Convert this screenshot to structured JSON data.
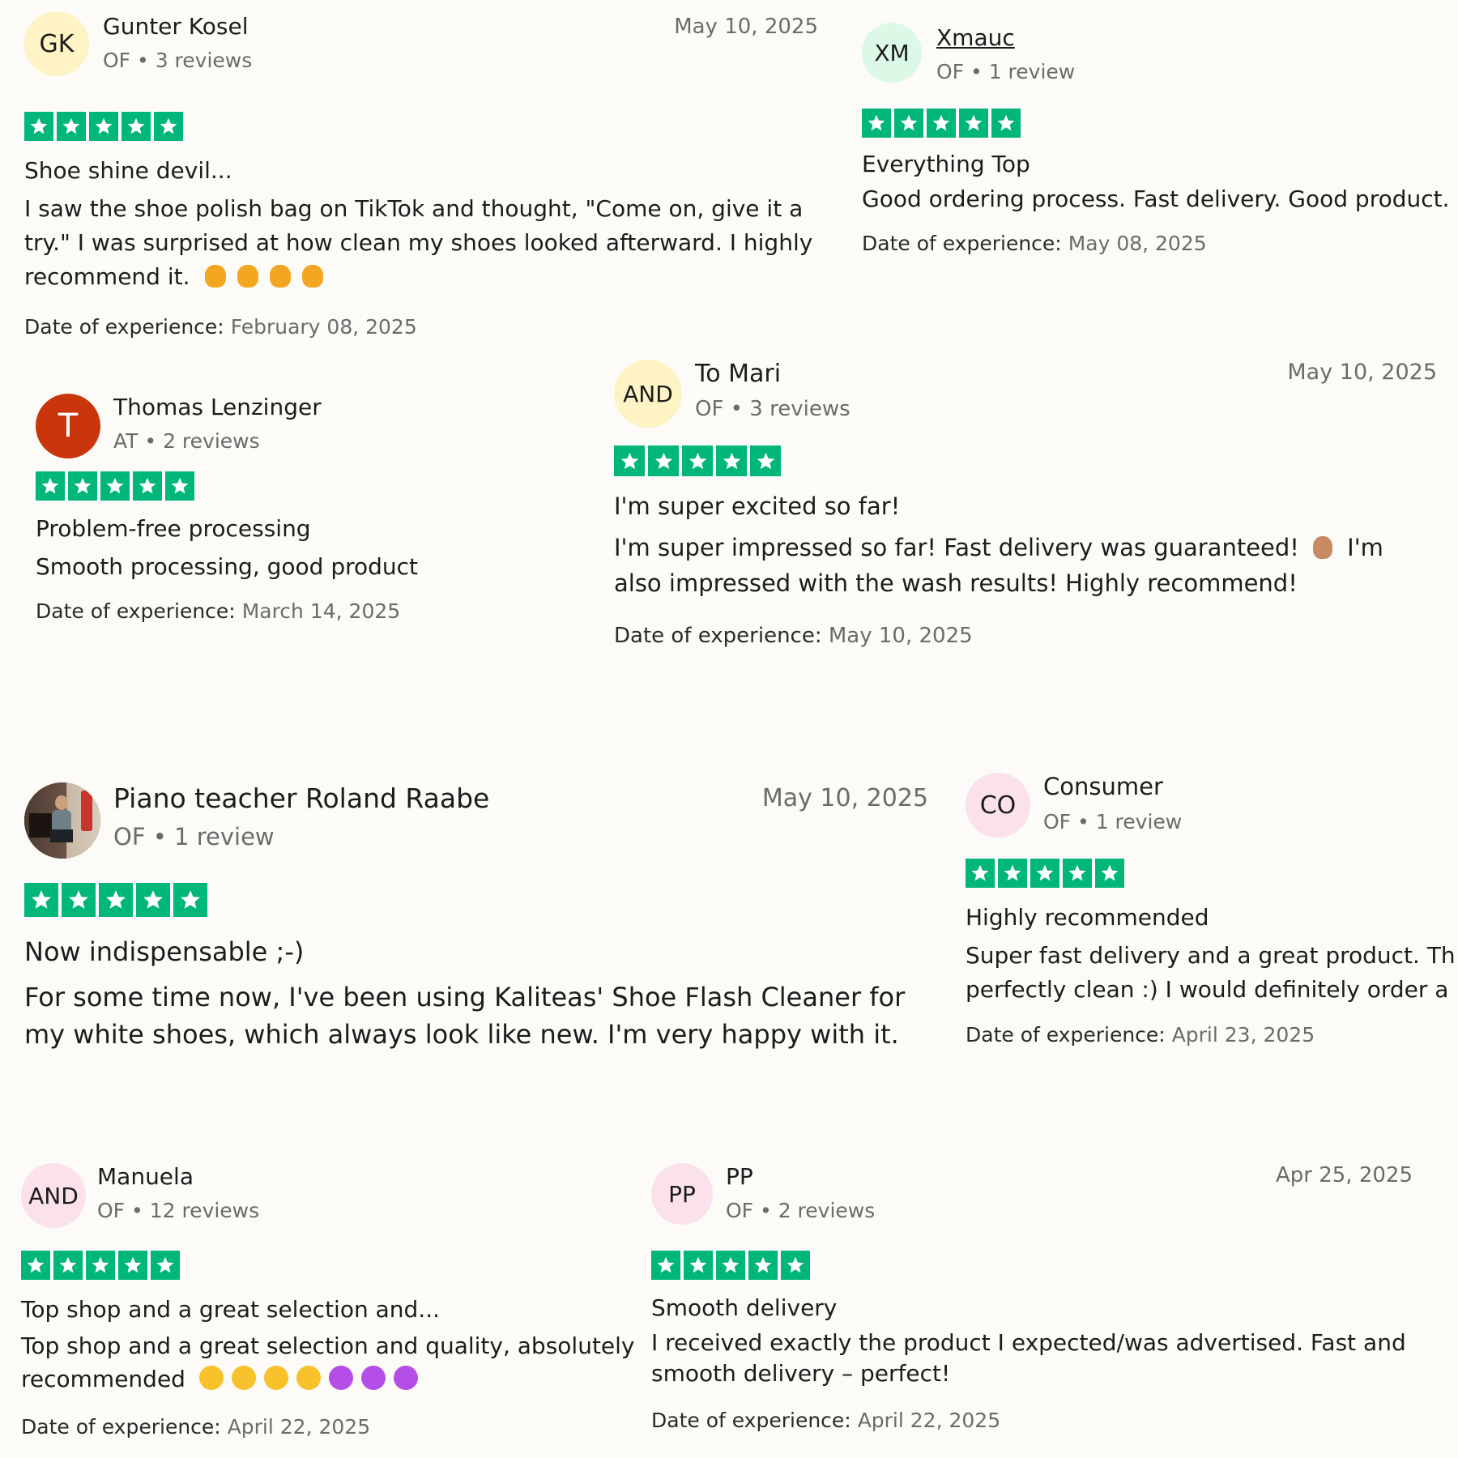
{
  "colors": {
    "star_green": "#00b67a",
    "text": "#1c1c1c",
    "muted": "#6b6b6b"
  },
  "reviews": [
    {
      "initials": "GK",
      "name": "Gunter Kosel",
      "meta": "OF • 3 reviews",
      "date": "May 10, 2025",
      "rating": 5,
      "title": "Shoe shine devil...",
      "body": "I saw the shoe polish bag on TikTok and thought, \"Come on, give it a try.\" I was surprised at how clean my shoes looked afterward. I highly recommend it.",
      "emojis": [
        "thumbs-up",
        "thumbs-up",
        "thumbs-up",
        "thumbs-up"
      ],
      "exp_label": "Date of experience:",
      "exp_date": "February 08, 2025",
      "avatar_color": "#fdf3c4"
    },
    {
      "initials": "XM",
      "name": "Xmauc",
      "meta": "OF • 1 review",
      "date": "",
      "rating": 5,
      "title": "Everything Top",
      "body": "Good ordering process. Fast delivery. Good product.",
      "exp_label": "Date of experience:",
      "exp_date": "May 08, 2025",
      "avatar_color": "#dcf8e6"
    },
    {
      "initials": "T",
      "name": "Thomas Lenzinger",
      "meta": "AT • 2 reviews",
      "date": "",
      "rating": 5,
      "title": "Problem-free processing",
      "body": "Smooth processing, good product",
      "exp_label": "Date of experience:",
      "exp_date": "March 14, 2025",
      "avatar_color": "#c9360c"
    },
    {
      "initials": "AND",
      "name": "To Mari",
      "meta": "OF • 3 reviews",
      "date": "May 10, 2025",
      "rating": 5,
      "title": "I'm super excited so far!",
      "body_a": "I'm super impressed so far! Fast delivery was guaranteed!",
      "body_b": "I'm also impressed with the wash results! Highly recommend!",
      "emojis": [
        "thumbs-up-medium-skin"
      ],
      "exp_label": "Date of experience:",
      "exp_date": "May 10, 2025",
      "avatar_color": "#fdf3c4"
    },
    {
      "initials": "",
      "name": "Piano teacher Roland Raabe",
      "meta": "OF • 1 review",
      "date": "May 10, 2025",
      "rating": 5,
      "title": "Now indispensable ;-)",
      "body": "For some time now, I've been using Kaliteas' Shoe Flash Cleaner for my white shoes, which always look like new. I'm very happy with it.",
      "avatar_icon": "profile-photo"
    },
    {
      "initials": "CO",
      "name": "Consumer",
      "meta": "OF • 1 review",
      "date": "",
      "rating": 5,
      "title": "Highly recommended",
      "body": "Super fast delivery and a great product. Th perfectly clean :) I would definitely order a",
      "exp_label": "Date of experience:",
      "exp_date": "April 23, 2025",
      "avatar_color": "#fbe1ec"
    },
    {
      "initials": "AND",
      "name": "Manuela",
      "meta": "OF • 12 reviews",
      "date": "",
      "rating": 5,
      "title": "Top shop and a great selection and...",
      "body": "Top shop and a great selection and quality, absolutely recommended",
      "emojis": [
        "smiling-face-with-hearts",
        "smiling-face-with-hearts",
        "smiling-face-with-hearts",
        "smiling-face-with-hearts",
        "smiling-devil-face",
        "smiling-devil-face",
        "smiling-devil-face"
      ],
      "exp_label": "Date of experience:",
      "exp_date": "April 22, 2025",
      "avatar_color": "#fbe1ec"
    },
    {
      "initials": "PP",
      "name": "PP",
      "meta": "OF • 2 reviews",
      "date": "Apr 25, 2025",
      "rating": 5,
      "title": "Smooth delivery",
      "body": "I received exactly the product I expected/was advertised. Fast and smooth delivery – perfect!",
      "exp_label": "Date of experience:",
      "exp_date": "April 22, 2025",
      "avatar_color": "#fbe1ec"
    }
  ]
}
